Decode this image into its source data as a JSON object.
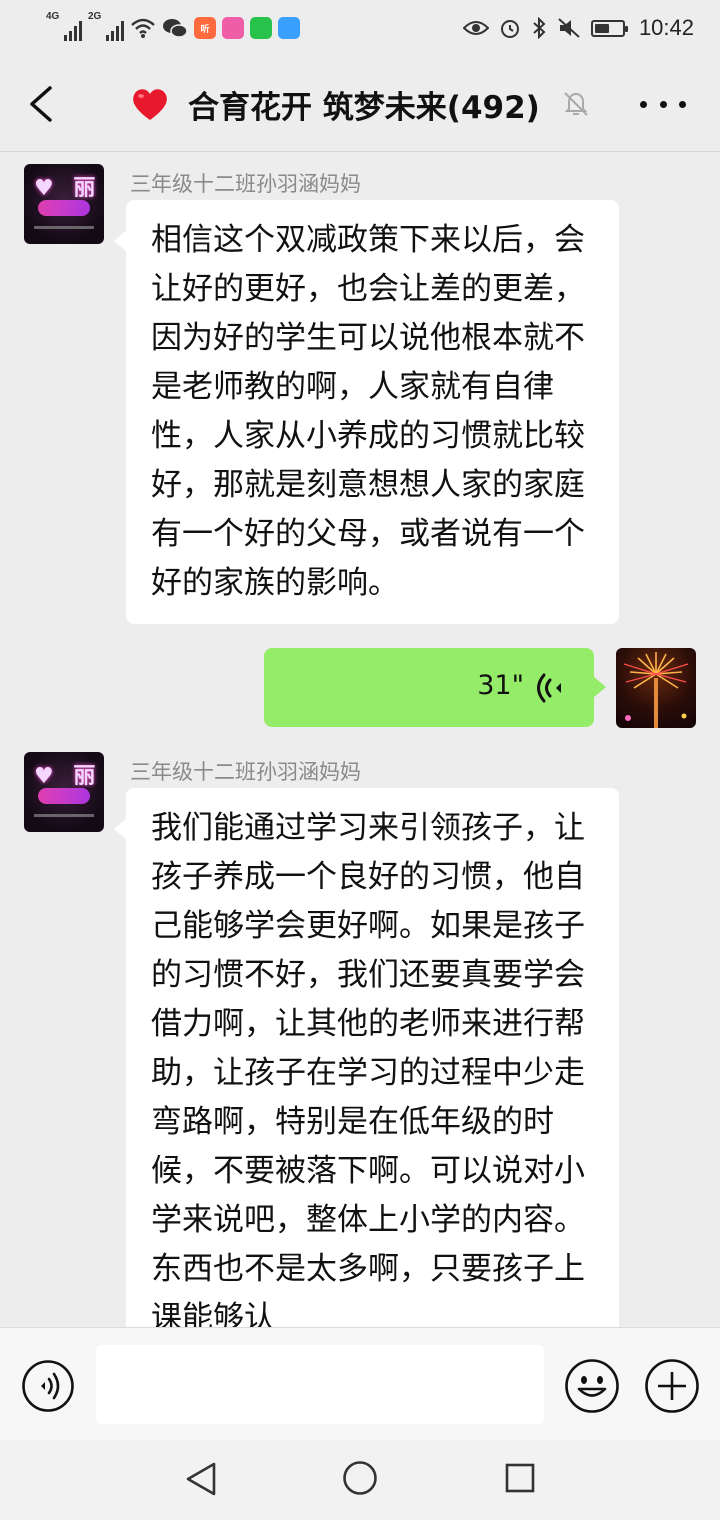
{
  "status_bar": {
    "network_1": "4G",
    "network_2": "2G",
    "app_badge_1": "听",
    "time": "10:42",
    "battery_level": 0.55
  },
  "header": {
    "title": "合育花开 筑梦未来(492)"
  },
  "messages": [
    {
      "sender": "三年级十二班孙羽涵妈妈",
      "text": "相信这个双减政策下来以后，会让好的更好，也会让差的更差，因为好的学生可以说他根本就不是老师教的啊，人家就有自律性，人家从小养成的习惯就比较好，那就是刻意想想人家的家庭有一个好的父母，或者说有一个好的家族的影响。"
    },
    {
      "voice_duration": "31\""
    },
    {
      "sender": "三年级十二班孙羽涵妈妈",
      "text": "我们能通过学习来引领孩子，让孩子养成一个良好的习惯，他自己能够学会更好啊。如果是孩子的习惯不好，我们还要真要学会借力啊，让其他的老师来进行帮助，让孩子在学习的过程中少走弯路啊，特别是在低年级的时候，不要被落下啊。可以说对小学来说吧，整体上小学的内容。东西也不是太多啊，只要孩子上课能够认"
    }
  ],
  "input": {
    "placeholder": ""
  },
  "colors": {
    "background": "#ededed",
    "bubble_incoming": "#ffffff",
    "bubble_outgoing": "#95ec69",
    "sender_name": "#8a8a8a"
  },
  "icons": {
    "back": "chevron-left-icon",
    "heart": "heart-emoji-icon",
    "mute": "bell-off-icon",
    "more": "more-dots-icon",
    "voice": "voice-wave-icon",
    "emoji": "smiley-icon",
    "plus": "plus-circle-icon"
  }
}
